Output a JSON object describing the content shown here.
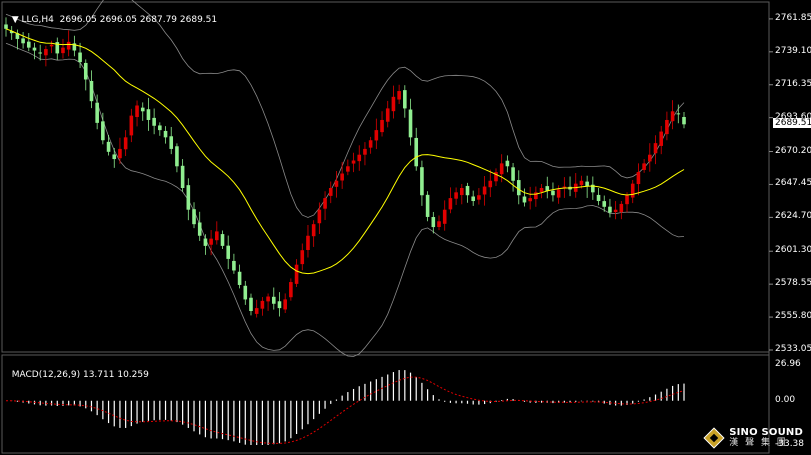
{
  "header": {
    "symbol_label": "LLG,H4",
    "open": "2696.05",
    "high": "2696.05",
    "low": "2687.79",
    "close": "2689.51"
  },
  "macd_header": {
    "label": "MACD(12,26,9)",
    "main": "13.711",
    "signal": "10.259"
  },
  "price_axis": {
    "ticks": [
      "2761.85",
      "2739.10",
      "2716.35",
      "2693.60",
      "2670.20",
      "2647.45",
      "2624.70",
      "2601.30",
      "2578.55",
      "2555.80",
      "2533.05"
    ],
    "current": "2689.51"
  },
  "macd_axis": {
    "ticks": [
      "26.96",
      "0.00",
      "-33.38"
    ]
  },
  "logo": {
    "en": "SINO SOUND",
    "cn": "漢 聲 集 團"
  },
  "colors": {
    "bull": "#e00000",
    "bear": "#90ee90",
    "ma": "#ffff00",
    "bands": "#8a8a8a",
    "signal": "#e00000",
    "histogram": "#ffffff"
  },
  "chart_data": {
    "type": "candlestick",
    "title": "LLG,H4",
    "ylim": [
      2533.05,
      2768
    ],
    "indicators": [
      "Moving Average",
      "Bollinger Bands",
      "MACD(12,26,9)"
    ],
    "close_path": [
      2755,
      2752,
      2748,
      2745,
      2742,
      2740,
      2738,
      2741,
      2744,
      2738,
      2742,
      2746,
      2740,
      2732,
      2720,
      2705,
      2690,
      2678,
      2670,
      2665,
      2672,
      2680,
      2695,
      2702,
      2698,
      2692,
      2688,
      2685,
      2680,
      2672,
      2660,
      2645,
      2630,
      2620,
      2612,
      2605,
      2610,
      2615,
      2605,
      2596,
      2588,
      2578,
      2568,
      2560,
      2562,
      2567,
      2570,
      2565,
      2562,
      2568,
      2580,
      2592,
      2602,
      2612,
      2620,
      2630,
      2638,
      2645,
      2650,
      2655,
      2660,
      2664,
      2668,
      2672,
      2678,
      2685,
      2692,
      2700,
      2708,
      2712,
      2700,
      2680,
      2660,
      2640,
      2625,
      2618,
      2622,
      2630,
      2638,
      2642,
      2645,
      2640,
      2636,
      2640,
      2646,
      2650,
      2656,
      2662,
      2660,
      2650,
      2640,
      2635,
      2638,
      2642,
      2645,
      2643,
      2640,
      2644,
      2646,
      2644,
      2648,
      2650,
      2646,
      2642,
      2636,
      2632,
      2628,
      2630,
      2634,
      2640,
      2648,
      2656,
      2662,
      2668,
      2676,
      2684,
      2692,
      2698,
      2696,
      2689
    ],
    "macd_hist_range": [
      -33.38,
      26.96
    ]
  }
}
